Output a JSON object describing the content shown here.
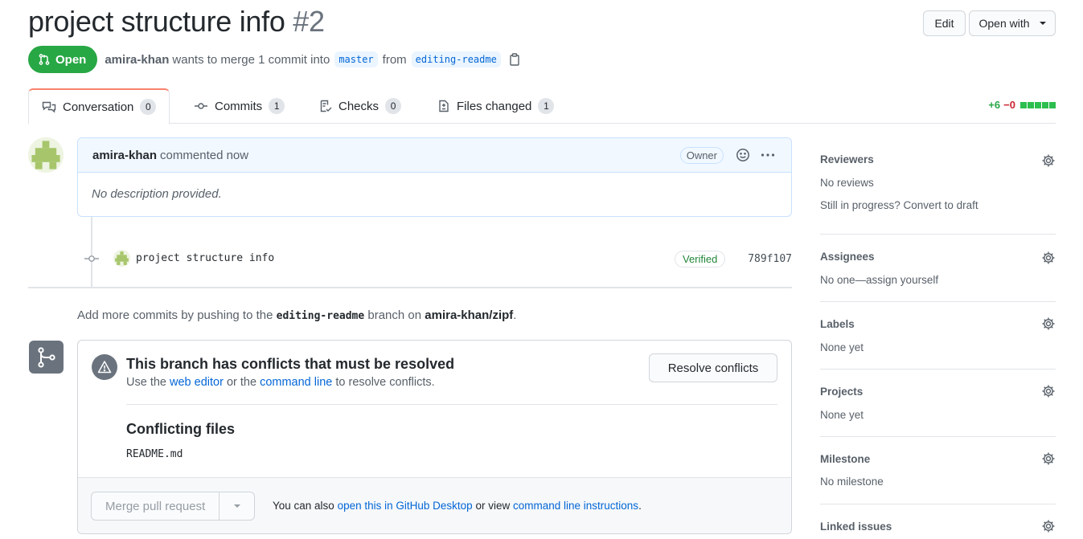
{
  "header": {
    "title": "project structure info",
    "number": "#2",
    "edit_label": "Edit",
    "open_with_label": "Open with"
  },
  "meta": {
    "state": "Open",
    "author": "amira-khan",
    "text_1": "wants to merge 1 commit into",
    "base_branch": "master",
    "text_2": "from",
    "head_branch": "editing-readme"
  },
  "tabs": [
    {
      "label": "Conversation",
      "count": "0",
      "icon": "comment-discussion-icon"
    },
    {
      "label": "Commits",
      "count": "1",
      "icon": "git-commit-icon"
    },
    {
      "label": "Checks",
      "count": "0",
      "icon": "checklist-icon"
    },
    {
      "label": "Files changed",
      "count": "1",
      "icon": "file-diff-icon"
    }
  ],
  "diffstat": {
    "additions": "+6",
    "deletions": "−0"
  },
  "comment": {
    "author": "amira-khan",
    "action": "commented now",
    "badge": "Owner",
    "body": "No description provided."
  },
  "commit": {
    "message": "project structure info",
    "verified": "Verified",
    "sha": "789f107"
  },
  "push_hint": {
    "prefix": "Add more commits by pushing to the",
    "branch": "editing-readme",
    "middle": "branch on",
    "repo": "amira-khan/zipf",
    "suffix": "."
  },
  "merge": {
    "conflict_title": "This branch has conflicts that must be resolved",
    "conflict_sub_1": "Use the",
    "web_editor": "web editor",
    "conflict_sub_2": "or the",
    "command_line": "command line",
    "conflict_sub_3": "to resolve conflicts.",
    "resolve_label": "Resolve conflicts",
    "conflicting_files_title": "Conflicting files",
    "files": [
      "README.md"
    ],
    "merge_label": "Merge pull request",
    "hint_1": "You can also",
    "desktop_link": "open this in GitHub Desktop",
    "hint_2": "or view",
    "instructions_link": "command line instructions",
    "hint_3": "."
  },
  "sidebar": {
    "reviewers": {
      "title": "Reviewers",
      "text": "No reviews",
      "extra": "Still in progress? Convert to draft"
    },
    "assignees": {
      "title": "Assignees",
      "text": "No one—assign yourself"
    },
    "labels": {
      "title": "Labels",
      "text": "None yet"
    },
    "projects": {
      "title": "Projects",
      "text": "None yet"
    },
    "milestone": {
      "title": "Milestone",
      "text": "No milestone"
    },
    "linked_issues": {
      "title": "Linked issues"
    }
  },
  "colors": {
    "open_green": "#28a745",
    "link_blue": "#0366d6",
    "tab_accent": "#f9826c",
    "deletion_red": "#cb2431"
  }
}
